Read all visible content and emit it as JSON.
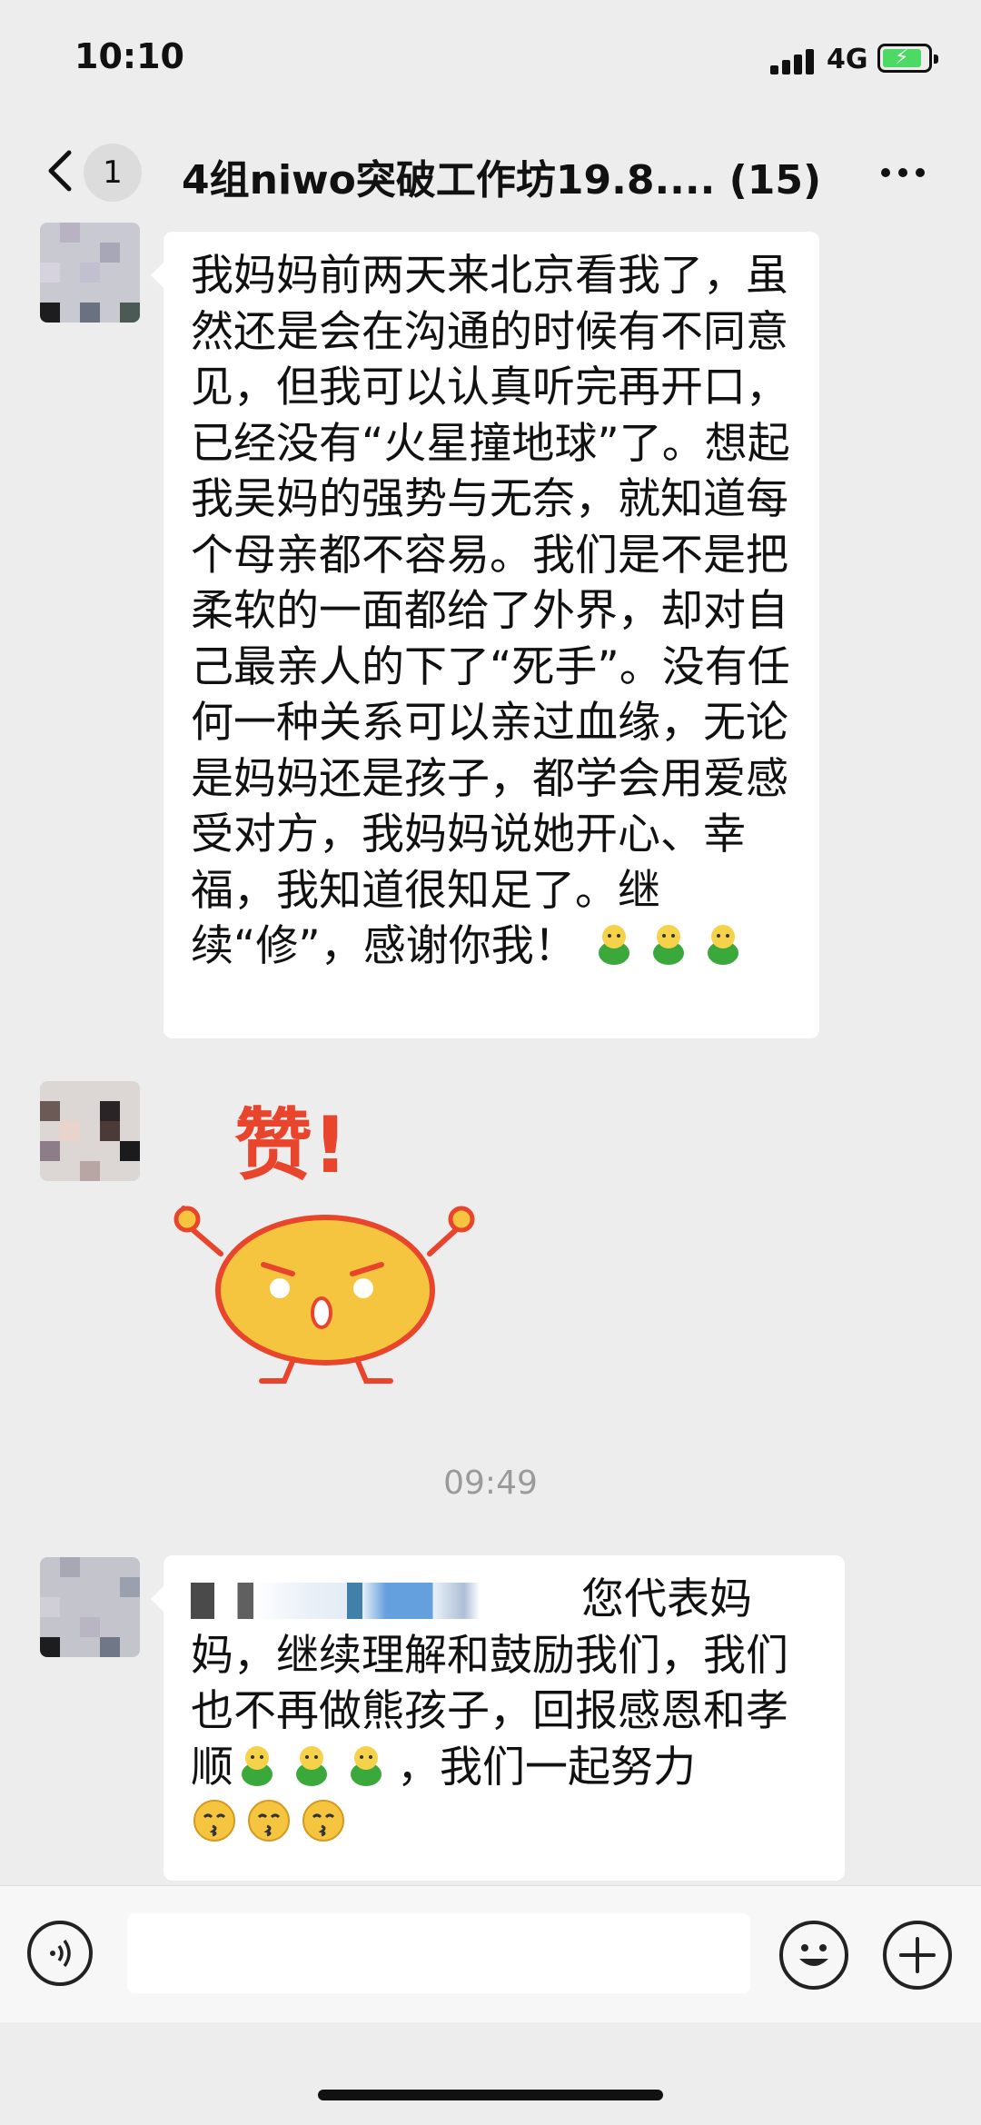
{
  "status_bar": {
    "time": "10:10",
    "network": "4G"
  },
  "nav": {
    "back_count": "1",
    "title": "4组niwo突破工作坊19.8.... (15)"
  },
  "messages": [
    {
      "text": "我妈妈前两天来北京看我了，虽然还是会在沟通的时候有不同意见，但我可以认真听完再开口，已经没有“火星撞地球”了。想起我吴妈的强势与无奈，就知道每个母亲都不容易。我们是不是把柔软的一面都给了外界，却对自己最亲人的下了“死手”。没有任何一种关系可以亲过血缘，无论是妈妈还是孩子，都学会用爱感受对方，我妈妈说她开心、幸福，我知道很知足了。继续“修”，感谢你我！",
      "trailing_emoji": [
        "thumbs-up-man-icon",
        "thumbs-up-man-icon",
        "thumbs-up-man-icon"
      ]
    },
    {
      "sticker": {
        "text": "赞!",
        "description": "yellow-bun-thumbs-up"
      }
    },
    {
      "timestamp": "09:49"
    },
    {
      "text_part1": "您代表妈妈，继续理解和鼓励我们，我们也不再做熊孩子，回报感恩和孝顺",
      "text_part2": "，我们一起努力",
      "mid_emoji": [
        "thumbs-up-man-icon",
        "thumbs-up-man-icon",
        "thumbs-up-man-icon"
      ],
      "trailing_emoji": [
        "kiss-face-icon",
        "kiss-face-icon",
        "kiss-face-icon"
      ]
    }
  ],
  "colors": {
    "background": "#ededed",
    "bubble": "#ffffff",
    "battery_fill": "#4cd964",
    "sticker_yellow": "#f6c540",
    "sticker_red": "#e8452c"
  }
}
